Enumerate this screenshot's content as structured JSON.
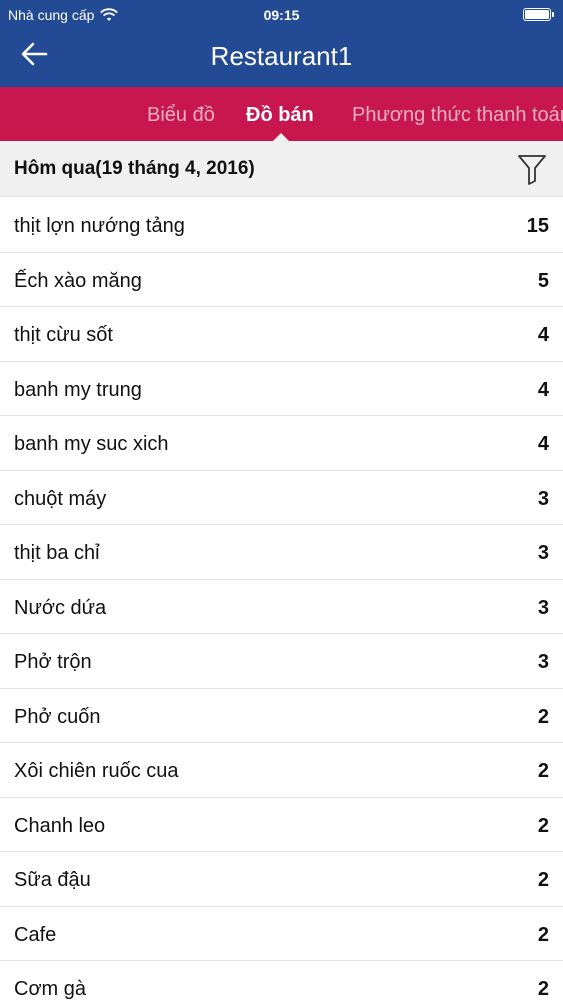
{
  "status_bar": {
    "carrier": "Nhà cung cấp",
    "time": "09:15"
  },
  "nav": {
    "title": "Restaurant1",
    "back_icon": "arrow-left-icon"
  },
  "tabs": [
    {
      "label": "Biểu đồ",
      "active": false
    },
    {
      "label": "Đồ bán",
      "active": true
    },
    {
      "label": "Phương thức thanh toán",
      "active": false
    }
  ],
  "date_header": {
    "label": "Hôm qua(19 tháng 4, 2016)",
    "filter_icon": "filter-icon"
  },
  "items": [
    {
      "name": "thịt lợn nướng tảng",
      "qty": "15"
    },
    {
      "name": "Ếch xào măng",
      "qty": "5"
    },
    {
      "name": "thịt cừu sốt",
      "qty": "4"
    },
    {
      "name": "banh my trung",
      "qty": "4"
    },
    {
      "name": "banh my suc xich",
      "qty": "4"
    },
    {
      "name": "chuột máy",
      "qty": "3"
    },
    {
      "name": "thịt ba chỉ",
      "qty": "3"
    },
    {
      "name": "Nước dứa",
      "qty": "3"
    },
    {
      "name": "Phở trộn",
      "qty": "3"
    },
    {
      "name": "Phở cuốn",
      "qty": "2"
    },
    {
      "name": "Xôi chiên ruốc cua",
      "qty": "2"
    },
    {
      "name": "Chanh leo",
      "qty": "2"
    },
    {
      "name": "Sữa đậu",
      "qty": "2"
    },
    {
      "name": "Cafe",
      "qty": "2"
    },
    {
      "name": "Cơm gà",
      "qty": "2"
    }
  ],
  "colors": {
    "header_bg": "#234a94",
    "tabs_bg": "#c8174f",
    "date_header_bg": "#f0f0f0"
  }
}
